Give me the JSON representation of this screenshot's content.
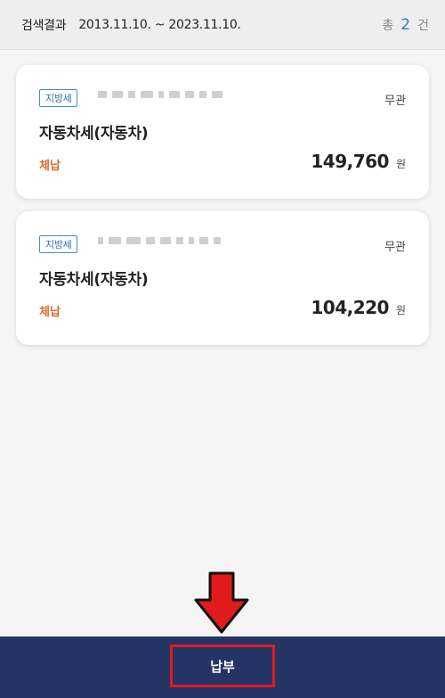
{
  "header": {
    "label": "검색결과",
    "date_range": "2013.11.10. ~ 2023.11.10.",
    "count_prefix": "총",
    "count": "2",
    "count_suffix": "건"
  },
  "results": [
    {
      "tag": "지방세",
      "status_right": "무관",
      "title": "자동차세(자동차)",
      "status": "체납",
      "amount": "149,760",
      "unit": "원"
    },
    {
      "tag": "지방세",
      "status_right": "무관",
      "title": "자동차세(자동차)",
      "status": "체납",
      "amount": "104,220",
      "unit": "원"
    }
  ],
  "footer": {
    "pay_label": "납부"
  },
  "colors": {
    "footer_bg": "#243465",
    "status": "#d96b2c",
    "count": "#2f7bd0",
    "highlight": "#e01b1b"
  },
  "icons": {
    "annotation_arrow": "down-arrow-icon"
  }
}
